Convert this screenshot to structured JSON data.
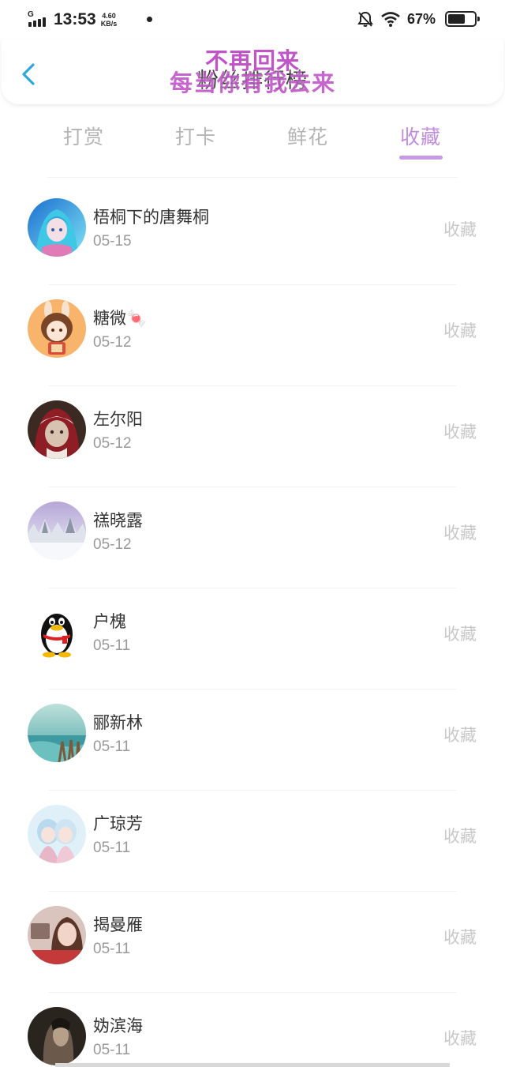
{
  "status_bar": {
    "network_type": "G",
    "time": "13:53",
    "speed_value": "4.60",
    "speed_unit": "KB/s",
    "battery_pct": "67%",
    "battery_level": 0.67,
    "icons": [
      "signal-icon",
      "mute-bell-icon",
      "wifi-icon",
      "battery-icon"
    ]
  },
  "header": {
    "title": "粉丝排行榜",
    "watermark_line1": "不再回来",
    "watermark_line2": "每当你有我去来",
    "back_icon": "chevron-left-icon"
  },
  "tabs": [
    {
      "label": "打赏",
      "active": false
    },
    {
      "label": "打卡",
      "active": false
    },
    {
      "label": "鲜花",
      "active": false
    },
    {
      "label": "收藏",
      "active": true
    }
  ],
  "accent_color": "#c28de0",
  "list": [
    {
      "name": "梧桐下的唐舞桐",
      "date": "05-15",
      "action": "收藏",
      "avatar": "anime-girl-blue-avatar"
    },
    {
      "name": "糖微🍬",
      "date": "05-12",
      "action": "收藏",
      "avatar": "rabbit-girl-avatar"
    },
    {
      "name": "左尔阳",
      "date": "05-12",
      "action": "收藏",
      "avatar": "red-hood-avatar"
    },
    {
      "name": "禚晓露",
      "date": "05-12",
      "action": "收藏",
      "avatar": "snow-landscape-avatar"
    },
    {
      "name": "户槐",
      "date": "05-11",
      "action": "收藏",
      "avatar": "qq-penguin-avatar"
    },
    {
      "name": "郦新林",
      "date": "05-11",
      "action": "收藏",
      "avatar": "seaside-avatar"
    },
    {
      "name": "广琼芳",
      "date": "05-11",
      "action": "收藏",
      "avatar": "anime-twins-avatar"
    },
    {
      "name": "揭曼雁",
      "date": "05-11",
      "action": "收藏",
      "avatar": "woman-portrait-avatar"
    },
    {
      "name": "妫滨海",
      "date": "05-11",
      "action": "收藏",
      "avatar": "dark-portrait-avatar"
    }
  ]
}
